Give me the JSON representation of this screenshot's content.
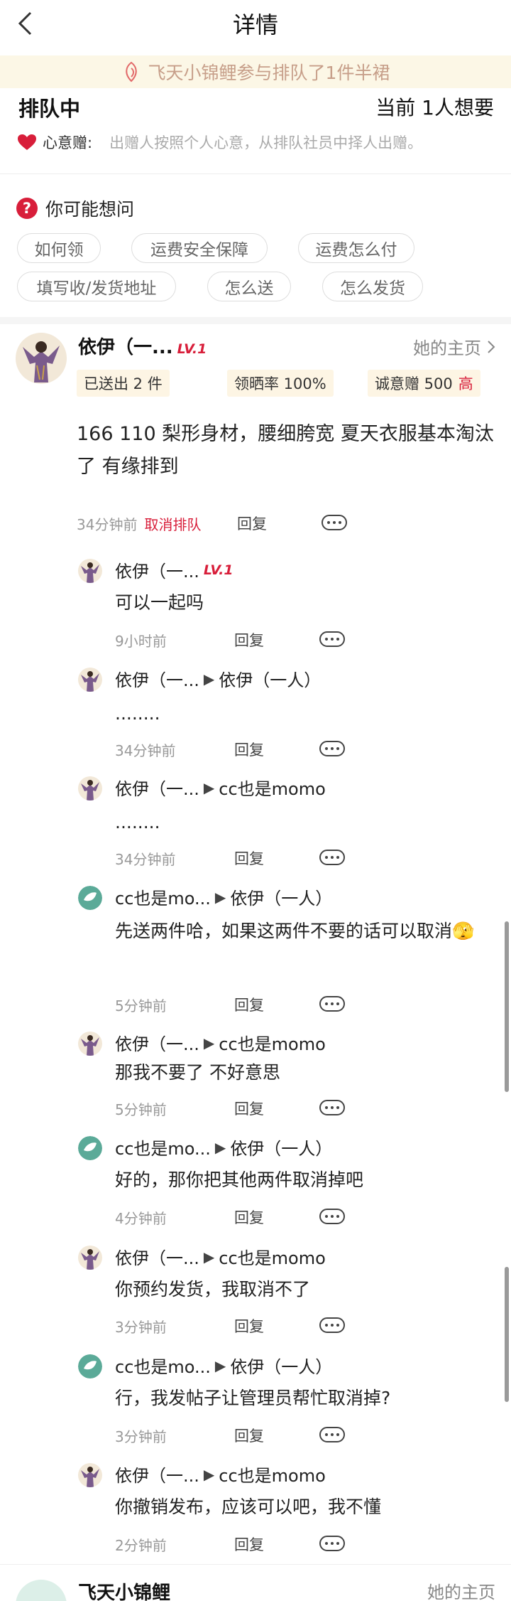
{
  "header": {
    "title": "详情",
    "back_icon": "chevron-left-icon"
  },
  "notice": {
    "text": "飞天小锦鲤参与排队了1件半裙",
    "icon": "koi-fish-icon"
  },
  "queue": {
    "title": "排队中",
    "count_text": "当前 1人想要"
  },
  "rule": {
    "icon": "heart-icon",
    "label": "心意赠:",
    "text": "出赠人按照个人心意，从排队社员中择人出赠。"
  },
  "faq": {
    "icon": "question-icon",
    "title": "你可能想问",
    "chips": [
      "如何领",
      "运费安全保障",
      "运费怎么付",
      "填写收/发货地址",
      "怎么送",
      "怎么发货"
    ]
  },
  "post": {
    "name": "依伊（一...",
    "level": "LV.1",
    "homepage_label": "她的主页",
    "tags": {
      "sent": "已送出 2 件",
      "rate": "领晒率 100%",
      "score": "诚意赠 500",
      "score_level": "高"
    },
    "text": "166 110 梨形身材，腰细胯宽 夏天衣服基本淘汰了 有缘排到",
    "time": "34分钟前",
    "cancel_label": "取消排队",
    "reply_label": "回复"
  },
  "replies": [
    {
      "from": "依伊（一...",
      "level": "LV.1",
      "to": "",
      "text": "可以一起吗",
      "time": "9小时前",
      "reply": "回复"
    },
    {
      "from": "依伊（一...",
      "level": "",
      "to": "依伊（一人）",
      "text": "........",
      "time": "34分钟前",
      "reply": "回复"
    },
    {
      "from": "依伊（一...",
      "level": "",
      "to": "cc也是momo",
      "text": "........",
      "time": "34分钟前",
      "reply": "回复"
    },
    {
      "from": "cc也是mo...",
      "level": "",
      "to": "依伊（一人）",
      "text": "先送两件哈，如果这两件不要的话可以取消🫣",
      "time": "5分钟前",
      "reply": "回复"
    },
    {
      "from": "依伊（一...",
      "level": "",
      "to": "cc也是momo",
      "text": "那我不要了  不好意思",
      "time": "5分钟前",
      "reply": "回复"
    },
    {
      "from": "cc也是mo...",
      "level": "",
      "to": "依伊（一人）",
      "text": "好的，那你把其他两件取消掉吧",
      "time": "4分钟前",
      "reply": "回复"
    },
    {
      "from": "依伊（一...",
      "level": "",
      "to": "cc也是momo",
      "text": "你预约发货，我取消不了",
      "time": "3分钟前",
      "reply": "回复"
    },
    {
      "from": "cc也是mo...",
      "level": "",
      "to": "依伊（一人）",
      "text": "行，我发帖子让管理员帮忙取消掉?",
      "time": "3分钟前",
      "reply": "回复"
    },
    {
      "from": "依伊（一...",
      "level": "",
      "to": "cc也是momo",
      "text": "你撤销发布，应该可以吧，我不懂",
      "time": "2分钟前",
      "reply": "回复"
    }
  ],
  "next_post": {
    "name": "飞天小锦鲤",
    "homepage_label": "她的主页"
  },
  "colors": {
    "accent": "#D81E3A",
    "notice_bg": "#FCF7E6",
    "tag_bg": "#FDF5E4"
  }
}
